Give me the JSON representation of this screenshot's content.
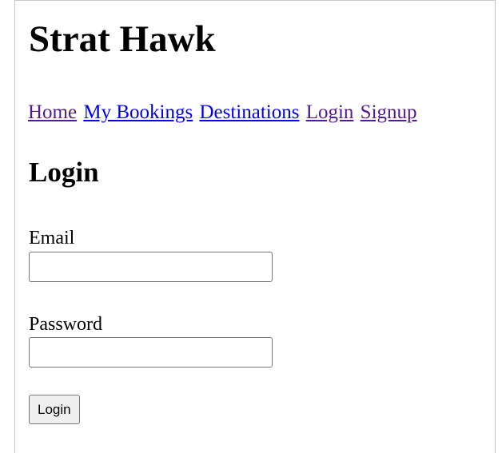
{
  "site": {
    "title": "Strat Hawk"
  },
  "nav": {
    "items": [
      {
        "label": "Home",
        "state": "visited"
      },
      {
        "label": "My Bookings",
        "state": "unvisited"
      },
      {
        "label": "Destinations",
        "state": "unvisited"
      },
      {
        "label": "Login",
        "state": "visited"
      },
      {
        "label": "Signup",
        "state": "visited"
      }
    ]
  },
  "login_form": {
    "heading": "Login",
    "email_label": "Email",
    "email_value": "",
    "password_label": "Password",
    "password_value": "",
    "submit_label": "Login"
  },
  "colors": {
    "link_unvisited": "#0000ee",
    "link_visited": "#551a8b",
    "button_bg": "#efefef"
  }
}
